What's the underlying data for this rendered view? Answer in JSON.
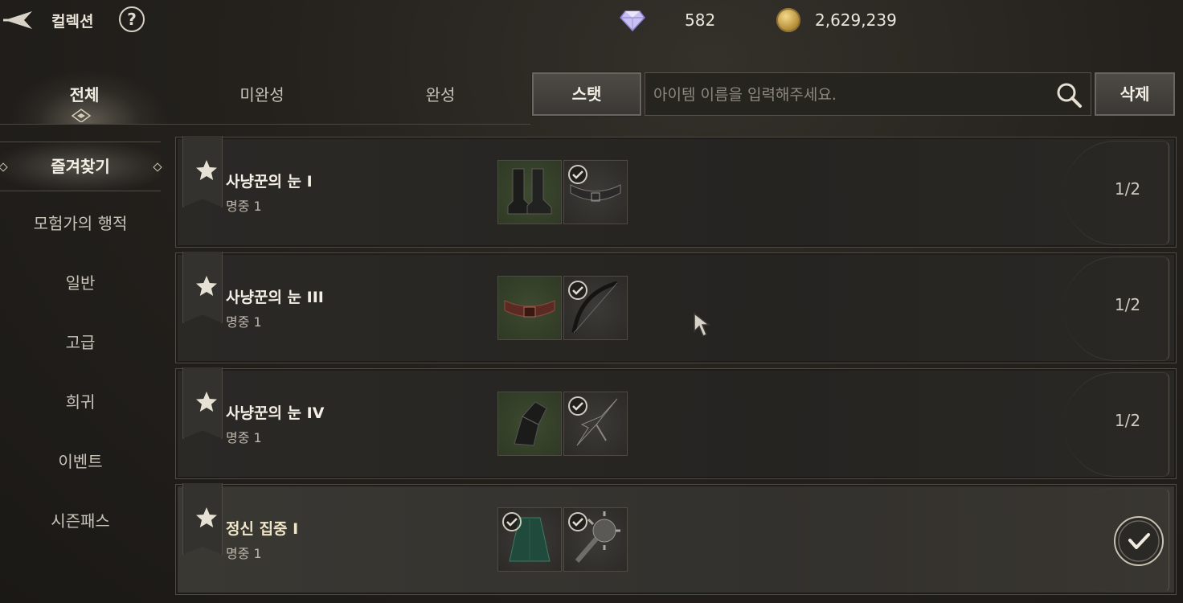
{
  "header": {
    "title": "컬렉션",
    "help_label": "?"
  },
  "currency": {
    "gems": "582",
    "gold": "2,629,239"
  },
  "tabs": [
    {
      "label": "전체",
      "active": true
    },
    {
      "label": "미완성",
      "active": false
    },
    {
      "label": "완성",
      "active": false
    }
  ],
  "toolbar": {
    "stat_button": "스탯",
    "search_placeholder": "아이템 이름을 입력해주세요.",
    "delete_button": "삭제"
  },
  "sidebar": {
    "items": [
      {
        "label": "즐겨찾기",
        "active": true
      },
      {
        "label": "모험가의 행적"
      },
      {
        "label": "일반"
      },
      {
        "label": "고급"
      },
      {
        "label": "희귀"
      },
      {
        "label": "이벤트"
      },
      {
        "label": "시즌패스"
      }
    ]
  },
  "collections": [
    {
      "name": "사냥꾼의 눈 I",
      "stat": "명중 1",
      "progress": "1/2",
      "complete": false,
      "slots": [
        {
          "icon": "boots-icon",
          "bg": "green",
          "owned": false
        },
        {
          "icon": "belt-icon",
          "bg": "dark",
          "owned": true
        }
      ]
    },
    {
      "name": "사냥꾼의 눈 III",
      "stat": "명중 1",
      "progress": "1/2",
      "complete": false,
      "slots": [
        {
          "icon": "belt-icon",
          "bg": "green",
          "owned": false
        },
        {
          "icon": "bow-icon",
          "bg": "dark",
          "owned": true
        }
      ]
    },
    {
      "name": "사냥꾼의 눈 IV",
      "stat": "명중 1",
      "progress": "1/2",
      "complete": false,
      "slots": [
        {
          "icon": "gauntlet-icon",
          "bg": "green",
          "owned": false
        },
        {
          "icon": "claw-icon",
          "bg": "dark",
          "owned": true
        }
      ]
    },
    {
      "name": "정신 집중 I",
      "stat": "명중 1",
      "progress": "",
      "complete": true,
      "slots": [
        {
          "icon": "cloak-icon",
          "bg": "dark",
          "owned": true
        },
        {
          "icon": "mace-icon",
          "bg": "dark",
          "owned": true
        }
      ]
    }
  ],
  "colors": {
    "accent_text": "#f4efe5",
    "muted_text": "#bdb7ab",
    "gold": "#c9a24a"
  }
}
